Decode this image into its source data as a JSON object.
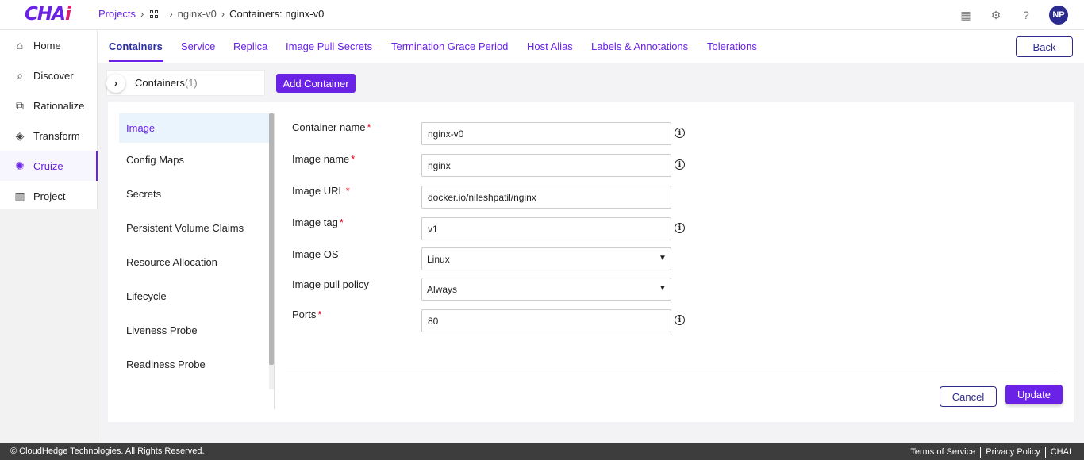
{
  "brand": {
    "name_main": "CHA",
    "name_accent": "i"
  },
  "breadcrumb": {
    "projects": "Projects",
    "project": "nginx-v0",
    "current": "Containers: nginx-v0"
  },
  "user": {
    "initials": "NP"
  },
  "sidebar": {
    "items": [
      {
        "label": "Home",
        "icon": "home-icon"
      },
      {
        "label": "Discover",
        "icon": "search-icon"
      },
      {
        "label": "Rationalize",
        "icon": "chart-icon"
      },
      {
        "label": "Transform",
        "icon": "layers-icon"
      },
      {
        "label": "Cruize",
        "icon": "fingerprint-icon"
      },
      {
        "label": "Project",
        "icon": "board-icon"
      }
    ]
  },
  "tabs": [
    "Containers",
    "Service",
    "Replica",
    "Image Pull Secrets",
    "Termination Grace Period",
    "Host Alias",
    "Labels & Annotations",
    "Tolerations"
  ],
  "back_label": "Back",
  "containers": {
    "label": "Containers",
    "count": "(1)",
    "add_label": "Add Container"
  },
  "menu": [
    "Image",
    "Config Maps",
    "Secrets",
    "Persistent Volume Claims",
    "Resource Allocation",
    "Lifecycle",
    "Liveness Probe",
    "Readiness Probe"
  ],
  "form": {
    "container_name": {
      "label": "Container name",
      "value": "nginx-v0"
    },
    "image_name": {
      "label": "Image name",
      "value": "nginx"
    },
    "image_url": {
      "label": "Image URL",
      "value": "docker.io/nileshpatil/nginx"
    },
    "image_tag": {
      "label": "Image tag",
      "value": "v1"
    },
    "image_os": {
      "label": "Image OS",
      "value": "Linux"
    },
    "pull_policy": {
      "label": "Image pull policy",
      "value": "Always"
    },
    "ports": {
      "label": "Ports",
      "value": "80"
    },
    "required_mark": "*",
    "info_glyph": "i"
  },
  "cancel_label": "Cancel",
  "update_label": "Update",
  "footer": {
    "copyright": "© CloudHedge Technologies. All Rights Reserved.",
    "terms": "Terms of Service",
    "privacy": "Privacy Policy",
    "brand": "CHAI"
  },
  "colors": {
    "accent": "#6a22e6",
    "navy": "#2e2a8a",
    "required": "#e0001b"
  }
}
